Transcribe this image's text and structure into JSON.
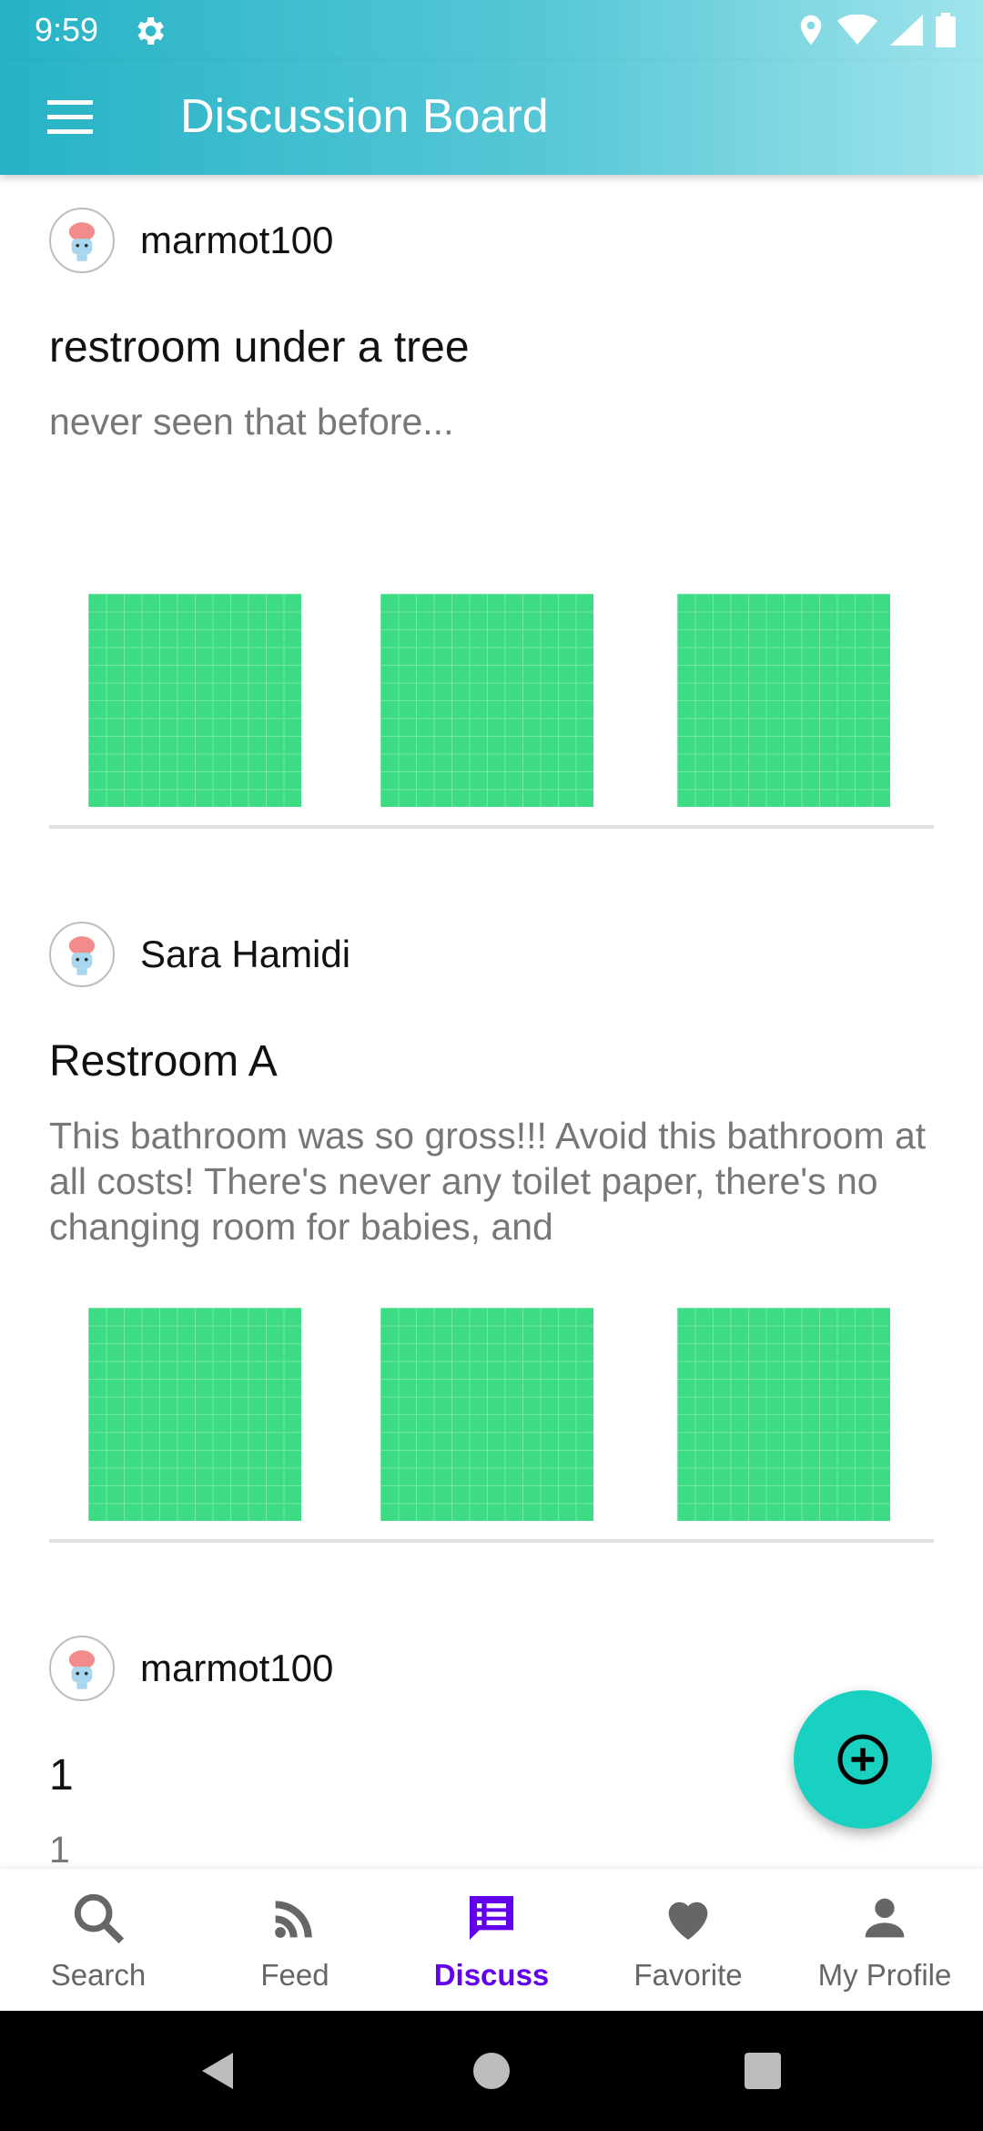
{
  "status_bar": {
    "time": "9:59",
    "icons": [
      "gear-icon",
      "location-icon",
      "wifi-icon",
      "signal-icon",
      "battery-icon"
    ]
  },
  "app_bar": {
    "title": "Discussion Board",
    "menu_icon": "menu-icon"
  },
  "posts": [
    {
      "username": "marmot100",
      "title": "restroom under a tree",
      "body": "never seen that before...",
      "image_count": 3
    },
    {
      "username": "Sara Hamidi",
      "title": "Restroom A",
      "body": "This bathroom was so gross!!! Avoid this bathroom at all costs! There's never any toilet paper, there's no changing room for babies, and",
      "image_count": 3
    },
    {
      "username": "marmot100",
      "title": "1",
      "body": "1",
      "image_count": 0
    }
  ],
  "fab": {
    "icon": "add-circle-icon"
  },
  "bottom_nav": {
    "active": "Discuss",
    "items": [
      {
        "label": "Search",
        "icon": "search-icon"
      },
      {
        "label": "Feed",
        "icon": "rss-feed-icon"
      },
      {
        "label": "Discuss",
        "icon": "discuss-icon"
      },
      {
        "label": "Favorite",
        "icon": "heart-icon"
      },
      {
        "label": "My Profile",
        "icon": "person-icon"
      }
    ]
  },
  "colors": {
    "header_gradient_start": "#26b3c6",
    "header_gradient_end": "#a0e4ec",
    "active_nav": "#6200ee",
    "fab": "#19d1c1",
    "thumbnail": "#3ddc84"
  }
}
